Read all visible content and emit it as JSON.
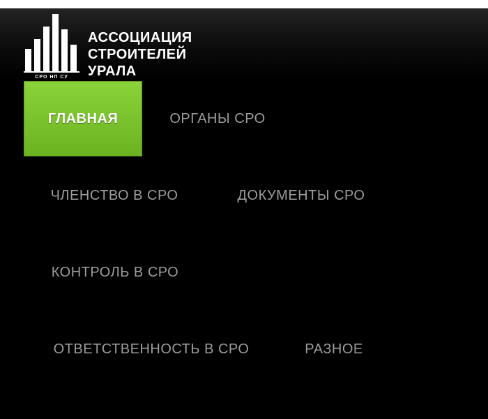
{
  "logo": {
    "line1": "АССОЦИАЦИЯ",
    "line2": "СТРОИТЕЛЕЙ",
    "line3": "УРАЛА",
    "mark_caption": "СРО НП СУ",
    "icon": "building-bars-icon"
  },
  "nav": {
    "items": [
      {
        "label": "ГЛАВНАЯ",
        "active": true
      },
      {
        "label": "ОРГАНЫ СРО",
        "active": false
      },
      {
        "label": "ЧЛЕНСТВО В СРО",
        "active": false
      },
      {
        "label": "ДОКУМЕНТЫ СРО",
        "active": false
      },
      {
        "label": "КОНТРОЛЬ В СРО",
        "active": false
      },
      {
        "label": "ОТВЕТСТВЕННОСТЬ В СРО",
        "active": false
      },
      {
        "label": "РАЗНОЕ",
        "active": false
      }
    ]
  },
  "colors": {
    "background": "#000000",
    "accent": "#7cc42c",
    "nav_text": "#9c9c9c",
    "active_text": "#ffffff"
  }
}
